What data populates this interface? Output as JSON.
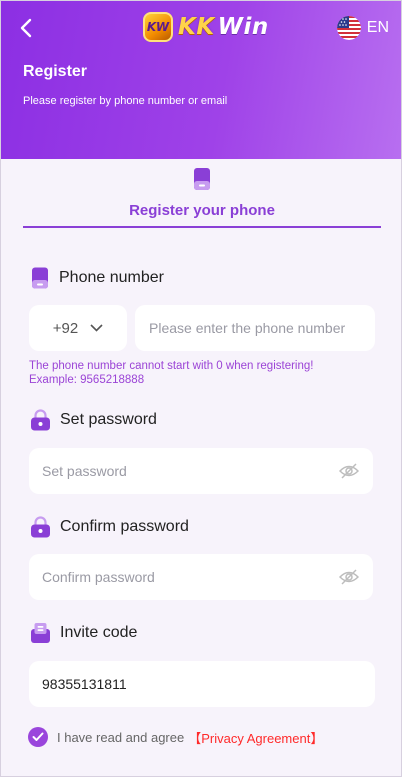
{
  "header": {
    "logo_badge": "KW",
    "logo_kk": "KK",
    "logo_win": "Win",
    "language": "EN",
    "title": "Register",
    "subtitle": "Please register by phone number or email"
  },
  "tab": {
    "label": "Register your phone"
  },
  "form": {
    "phone_label": "Phone number",
    "country_code": "+92",
    "phone_placeholder": "Please enter the phone number",
    "phone_hint_line1": "The phone number cannot start with 0 when registering!",
    "phone_hint_line2": "Example: 9565218888",
    "password_label": "Set password",
    "password_placeholder": "Set password",
    "confirm_label": "Confirm password",
    "confirm_placeholder": "Confirm password",
    "invite_label": "Invite code",
    "invite_value": "98355131811"
  },
  "agreement": {
    "checked": true,
    "text": "I have read and agree",
    "link": "【Privacy Agreement】"
  },
  "colors": {
    "primary": "#8a3fd6",
    "header_start": "#8c2fe3",
    "header_end": "#b86ff0",
    "link_red": "#ff2a2a",
    "background": "#f7f3fb"
  },
  "icons": [
    "back-arrow-icon",
    "us-flag-icon",
    "phone-icon",
    "lock-icon",
    "eye-off-icon",
    "invite-icon",
    "checkmark-icon"
  ]
}
